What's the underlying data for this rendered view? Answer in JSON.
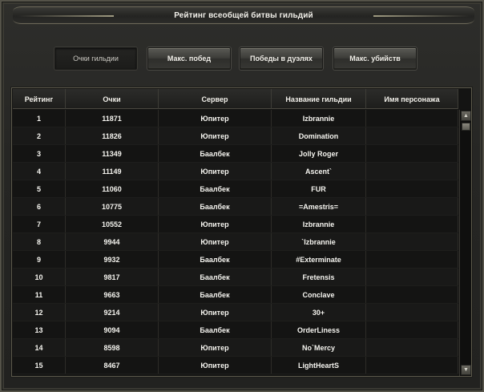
{
  "window": {
    "title": "Рейтинг всеобщей битвы гильдий"
  },
  "tabs": [
    {
      "label": "Очки гильдии",
      "active": true
    },
    {
      "label": "Макс. побед",
      "active": false
    },
    {
      "label": "Победы в дуэлях",
      "active": false
    },
    {
      "label": "Макс. убийств",
      "active": false
    }
  ],
  "table": {
    "headers": [
      "Рейтинг",
      "Очки",
      "Сервер",
      "Название гильдии",
      "Имя персонажа"
    ],
    "rows": [
      {
        "rank": "1",
        "points": "11871",
        "server": "Юпитер",
        "guild": "Izbrannie",
        "character": ""
      },
      {
        "rank": "2",
        "points": "11826",
        "server": "Юпитер",
        "guild": "Domination",
        "character": ""
      },
      {
        "rank": "3",
        "points": "11349",
        "server": "Баалбек",
        "guild": "Jolly Roger",
        "character": ""
      },
      {
        "rank": "4",
        "points": "11149",
        "server": "Юпитер",
        "guild": "Ascent`",
        "character": ""
      },
      {
        "rank": "5",
        "points": "11060",
        "server": "Баалбек",
        "guild": "FUR",
        "character": ""
      },
      {
        "rank": "6",
        "points": "10775",
        "server": "Баалбек",
        "guild": "=Amestris=",
        "character": ""
      },
      {
        "rank": "7",
        "points": "10552",
        "server": "Юпитер",
        "guild": "Izbrannie",
        "character": ""
      },
      {
        "rank": "8",
        "points": "9944",
        "server": "Юпитер",
        "guild": "`Izbrannie",
        "character": ""
      },
      {
        "rank": "9",
        "points": "9932",
        "server": "Баалбек",
        "guild": "#Exterminate",
        "character": ""
      },
      {
        "rank": "10",
        "points": "9817",
        "server": "Баалбек",
        "guild": "Fretensis",
        "character": ""
      },
      {
        "rank": "11",
        "points": "9663",
        "server": "Баалбек",
        "guild": "Conclave",
        "character": ""
      },
      {
        "rank": "12",
        "points": "9214",
        "server": "Юпитер",
        "guild": "30+",
        "character": ""
      },
      {
        "rank": "13",
        "points": "9094",
        "server": "Баалбек",
        "guild": "OrderLiness",
        "character": ""
      },
      {
        "rank": "14",
        "points": "8598",
        "server": "Юпитер",
        "guild": "No`Mercy",
        "character": ""
      },
      {
        "rank": "15",
        "points": "8467",
        "server": "Юпитер",
        "guild": "LightHeartS",
        "character": ""
      }
    ]
  },
  "scrollbar": {
    "up_icon": "▲",
    "down_icon": "▼"
  },
  "colors": {
    "background": "#262624",
    "frame": "#5d5a4c",
    "text": "#f5f4ef"
  }
}
